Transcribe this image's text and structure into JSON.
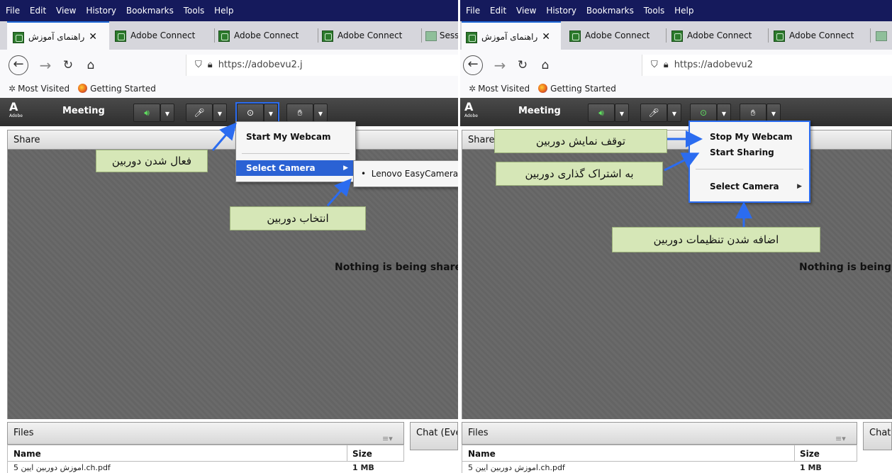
{
  "menubar": [
    "File",
    "Edit",
    "View",
    "History",
    "Bookmarks",
    "Tools",
    "Help"
  ],
  "tabs": {
    "active_label": "راهنمای آموزش",
    "other_label": "Adobe Connect",
    "extra_left": "Sess"
  },
  "url": {
    "left": "https://adobevu2.j",
    "right": "https://adobevu2"
  },
  "bookmarks": {
    "most_visited": "Most Visited",
    "getting_started": "Getting Started"
  },
  "adobe": {
    "logo_letter": "A",
    "logo_text": "Adobe",
    "meeting": "Meeting"
  },
  "share": {
    "title": "Share",
    "left_message": "Nothing is being share",
    "right_message": "Nothing is being s"
  },
  "files": {
    "title": "Files",
    "col_name": "Name",
    "col_size": "Size",
    "row_name_cut": "اموزش دوربین ایین 5.ch.pdf",
    "row_size_cut": "1 MB"
  },
  "chat": {
    "left_title": "Chat  (Eve",
    "right_title": "Chat"
  },
  "left_menu": {
    "start_webcam": "Start My Webcam",
    "select_camera": "Select Camera",
    "camera_option": "Lenovo EasyCamera"
  },
  "right_menu": {
    "stop_webcam": "Stop My Webcam",
    "start_sharing": "Start Sharing",
    "select_camera": "Select Camera"
  },
  "callouts": {
    "activate_camera": "فعال شدن دوربین",
    "choose_camera": "انتخاب دوربین",
    "stop_camera": "توقف نمایش دوربین",
    "share_camera": "به اشتراک گذاری دوربین",
    "add_settings": "اضافه شدن تنظیمات دوربین"
  },
  "colors": {
    "menubar_bg": "#151a5c",
    "callout_bg": "#d6e7b7",
    "highlight_blue": "#2b6cf0",
    "mic_green": "#5fe35f"
  },
  "icons": {
    "back": "back-arrow-icon",
    "forward": "forward-arrow-icon",
    "reload": "reload-icon",
    "home": "home-icon",
    "shield": "shield-icon",
    "lock": "lock-icon",
    "speaker": "speaker-icon",
    "mic": "microphone-icon",
    "webcam": "webcam-icon",
    "raise_hand": "raise-hand-icon"
  }
}
